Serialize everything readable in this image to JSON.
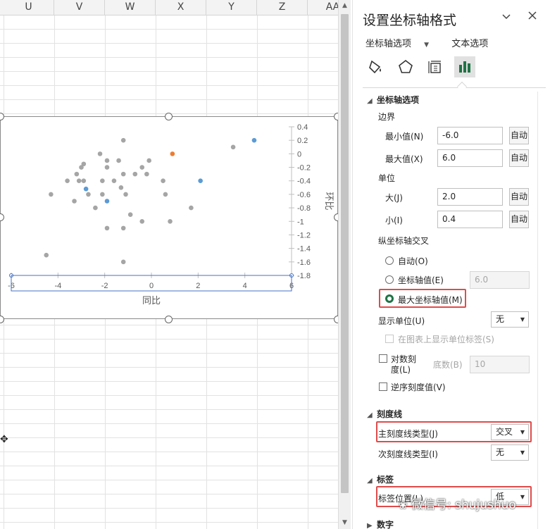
{
  "sheet": {
    "columns": [
      "U",
      "V",
      "W",
      "X",
      "Y",
      "Z",
      "AA"
    ]
  },
  "chart_data": {
    "type": "scatter",
    "xlabel": "同比",
    "ylabel": "环比",
    "xlim": [
      -6,
      6
    ],
    "ylim": [
      -1.8,
      0.4
    ],
    "x_ticks": [
      "-6",
      "-4",
      "-2",
      "0",
      "2",
      "4",
      "6"
    ],
    "y_ticks": [
      "0.4",
      "0.2",
      "0",
      "-0.2",
      "-0.4",
      "-0.6",
      "-0.8",
      "-1",
      "-1.2",
      "-1.4",
      "-1.6",
      "-1.8"
    ],
    "series": [
      {
        "color": "#a5a5a5",
        "points": [
          [
            -1.2,
            0.2
          ],
          [
            -2.2,
            0.0
          ],
          [
            -1.9,
            -0.1
          ],
          [
            -2.9,
            -0.15
          ],
          [
            -1.4,
            -0.1
          ],
          [
            -0.1,
            -0.1
          ],
          [
            -0.4,
            -0.2
          ],
          [
            -1.9,
            -0.2
          ],
          [
            -3.0,
            -0.2
          ],
          [
            -3.2,
            -0.3
          ],
          [
            -1.2,
            -0.3
          ],
          [
            -0.7,
            -0.3
          ],
          [
            -0.2,
            -0.3
          ],
          [
            -3.6,
            -0.4
          ],
          [
            -2.9,
            -0.4
          ],
          [
            -2.1,
            -0.4
          ],
          [
            -1.6,
            -0.4
          ],
          [
            0.5,
            -0.4
          ],
          [
            -3.1,
            -0.4
          ],
          [
            -1.3,
            -0.5
          ],
          [
            -4.3,
            -0.6
          ],
          [
            -2.7,
            -0.6
          ],
          [
            -2.1,
            -0.6
          ],
          [
            -1.1,
            -0.6
          ],
          [
            0.6,
            -0.6
          ],
          [
            -3.3,
            -0.7
          ],
          [
            -2.4,
            -0.8
          ],
          [
            -0.9,
            -0.9
          ],
          [
            1.7,
            -0.8
          ],
          [
            -0.4,
            -1.0
          ],
          [
            0.8,
            -1.0
          ],
          [
            -1.9,
            -1.1
          ],
          [
            -1.2,
            -1.1
          ],
          [
            -4.5,
            -1.5
          ],
          [
            -1.2,
            -1.6
          ],
          [
            3.5,
            0.1
          ]
        ]
      },
      {
        "color": "#5b9bd5",
        "points": [
          [
            4.4,
            0.2
          ],
          [
            2.1,
            -0.4
          ],
          [
            -2.8,
            -0.52
          ],
          [
            -1.9,
            -0.7
          ]
        ]
      },
      {
        "color": "#ed7d31",
        "points": [
          [
            0.9,
            0.0
          ]
        ]
      }
    ]
  },
  "pane": {
    "title": "设置坐标轴格式",
    "tab_axis_options": "坐标轴选项",
    "tab_text_options": "文本选项",
    "section_axis_options": "坐标轴选项",
    "bounds_label": "边界",
    "min_label": "最小值(N)",
    "min_value": "-6.0",
    "max_label": "最大值(X)",
    "max_value": "6.0",
    "auto": "自动",
    "units_label": "单位",
    "major_label": "大(J)",
    "major_value": "2.0",
    "minor_label": "小(I)",
    "minor_value": "0.4",
    "cross_label": "纵坐标轴交叉",
    "radio_auto": "自动(O)",
    "radio_axis_value": "坐标轴值(E)",
    "axis_value": "6.0",
    "radio_max": "最大坐标轴值(M)",
    "display_units_label": "显示单位(U)",
    "display_units_value": "无",
    "show_units_label": "在图表上显示单位标签(S)",
    "log_label_1": "对数刻",
    "log_label_2": "度(L)",
    "base_label": "底数(B)",
    "base_value": "10",
    "reverse_label": "逆序刻度值(V)",
    "section_ticks": "刻度线",
    "major_tick_label": "主刻度线类型(J)",
    "major_tick_value": "交叉",
    "minor_tick_label": "次刻度线类型(I)",
    "minor_tick_value": "无",
    "section_labels": "标签",
    "label_pos_label": "标签位置(L)",
    "label_pos_value": "低",
    "section_number": "数字"
  },
  "watermark": "微信号: shujushuo",
  "colors": {
    "accent_green": "#217346",
    "highlight_red": "#e04b4b"
  }
}
